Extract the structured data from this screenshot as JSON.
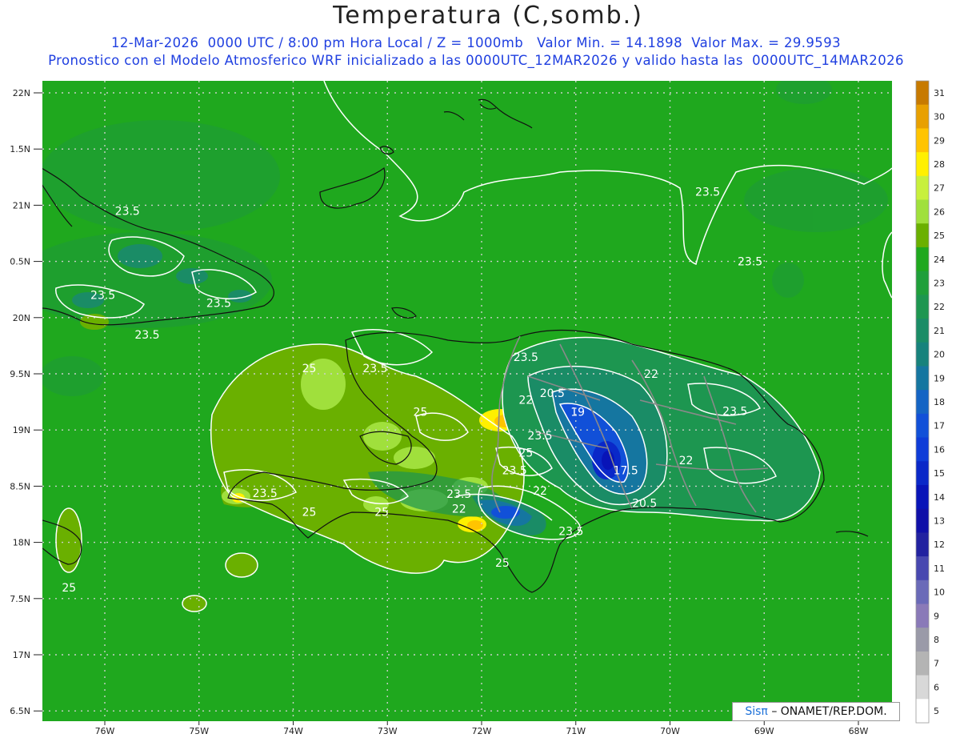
{
  "title": "Temperatura (C,somb.)",
  "subtitle_line1": "12-Mar-2026  0000 UTC / 8:00 pm Hora Local / Z = 1000mb   Valor Min. = 14.1898  Valor Max. = 29.9593",
  "subtitle_line2": "Pronostico con el Modelo Atmosferico WRF inicializado a las 0000UTC_12MAR2026 y valido hasta las  0000UTC_14MAR2026",
  "credit": {
    "brand": "Sis",
    "pi": "π",
    "rest": "– ONAMET/REP.DOM."
  },
  "lat_labels": [
    "22N",
    "1.5N",
    "21N",
    "0.5N",
    "20N",
    "9.5N",
    "19N",
    "8.5N",
    "18N",
    "7.5N",
    "17N",
    "6.5N"
  ],
  "lon_labels": [
    "76W",
    "75W",
    "74W",
    "73W",
    "72W",
    "71W",
    "70W",
    "69W",
    "68W"
  ],
  "colorbar": {
    "labels": [
      "31",
      "30",
      "29",
      "28",
      "27",
      "26",
      "25",
      "24",
      "23",
      "22",
      "21",
      "20",
      "19",
      "18",
      "17",
      "16",
      "15",
      "14",
      "13",
      "12",
      "11",
      "10",
      "9",
      "8",
      "7",
      "6",
      "5"
    ],
    "colors": [
      "#c77a00",
      "#e8a000",
      "#ffc400",
      "#fff000",
      "#c8f03c",
      "#a0e03c",
      "#6ab000",
      "#1fa81e",
      "#1f9f3a",
      "#1d9650",
      "#1a8c66",
      "#17827c",
      "#1576a0",
      "#1464c4",
      "#1150d8",
      "#0e3cd8",
      "#0a28c8",
      "#0814b8",
      "#1010a8",
      "#2222a0",
      "#4848b0",
      "#6a6ab8",
      "#8a7ab8",
      "#9a9aa8",
      "#b4b4b4",
      "#d8d8d8",
      "#ffffff"
    ]
  },
  "contour_labels": [
    {
      "text": "23.5",
      "lon": -69.6,
      "lat": 21.12
    },
    {
      "text": "23.5",
      "lon": -69.15,
      "lat": 20.5
    },
    {
      "text": "23.5",
      "lon": -75.76,
      "lat": 20.95
    },
    {
      "text": "23.5",
      "lon": -76.02,
      "lat": 20.2
    },
    {
      "text": "23.5",
      "lon": -74.79,
      "lat": 20.13
    },
    {
      "text": "23.5",
      "lon": -75.55,
      "lat": 19.85
    },
    {
      "text": "25",
      "lon": -73.83,
      "lat": 19.55
    },
    {
      "text": "23.5",
      "lon": -73.13,
      "lat": 19.55
    },
    {
      "text": "23.5",
      "lon": -71.53,
      "lat": 19.65
    },
    {
      "text": "22",
      "lon": -70.2,
      "lat": 19.5
    },
    {
      "text": "20.5",
      "lon": -71.25,
      "lat": 19.33
    },
    {
      "text": "22",
      "lon": -71.53,
      "lat": 19.27
    },
    {
      "text": "25",
      "lon": -72.65,
      "lat": 19.16
    },
    {
      "text": "19",
      "lon": -70.98,
      "lat": 19.16
    },
    {
      "text": "23.5",
      "lon": -71.38,
      "lat": 18.95
    },
    {
      "text": "25",
      "lon": -71.53,
      "lat": 18.8
    },
    {
      "text": "23.5",
      "lon": -71.65,
      "lat": 18.64
    },
    {
      "text": "17.5",
      "lon": -70.47,
      "lat": 18.64
    },
    {
      "text": "22",
      "lon": -69.83,
      "lat": 18.73
    },
    {
      "text": "23.5",
      "lon": -69.31,
      "lat": 19.17
    },
    {
      "text": "22",
      "lon": -71.38,
      "lat": 18.46
    },
    {
      "text": "23.5",
      "lon": -72.24,
      "lat": 18.43
    },
    {
      "text": "22",
      "lon": -72.24,
      "lat": 18.3
    },
    {
      "text": "20.5",
      "lon": -70.27,
      "lat": 18.35
    },
    {
      "text": "23.5",
      "lon": -71.05,
      "lat": 18.1
    },
    {
      "text": "23.5",
      "lon": -74.3,
      "lat": 18.44
    },
    {
      "text": "25",
      "lon": -73.83,
      "lat": 18.27
    },
    {
      "text": "25",
      "lon": -73.06,
      "lat": 18.27
    },
    {
      "text": "25",
      "lon": -71.78,
      "lat": 17.82
    },
    {
      "text": "25",
      "lon": -76.38,
      "lat": 17.6
    }
  ]
}
